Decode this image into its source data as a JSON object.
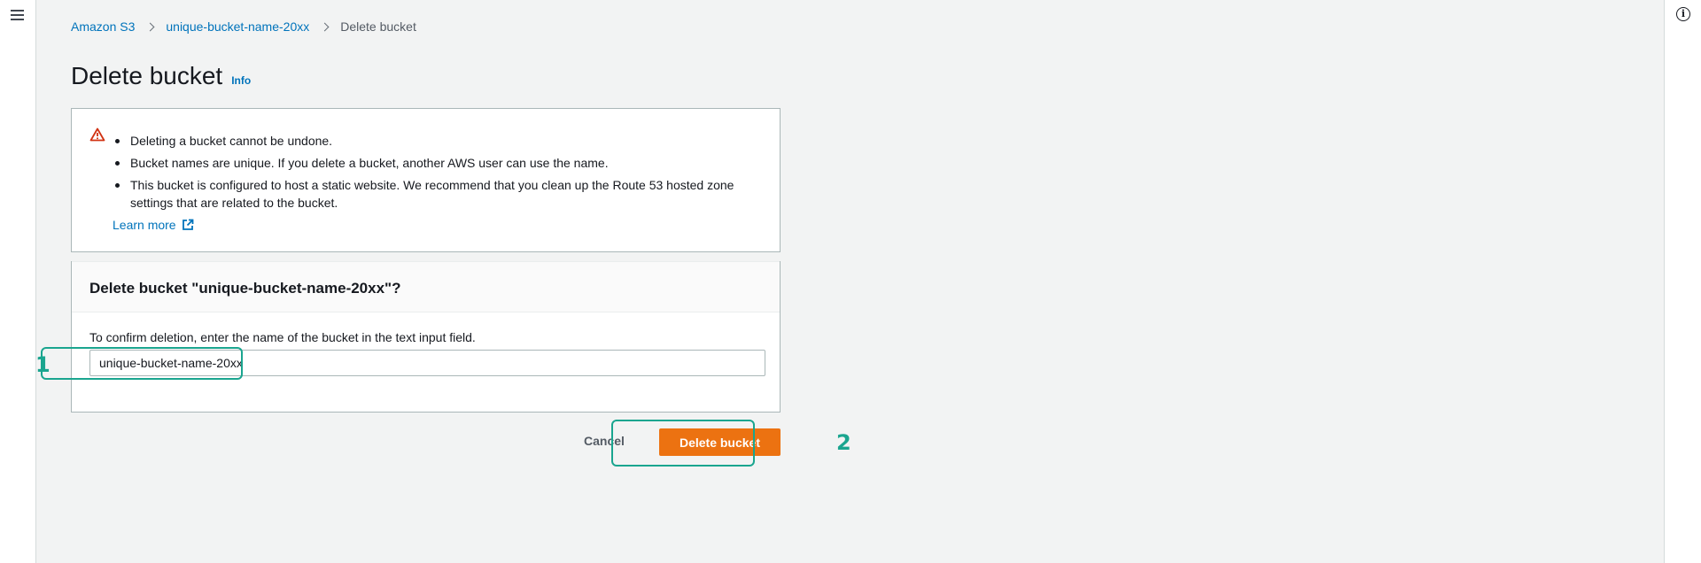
{
  "breadcrumb": {
    "items": [
      "Amazon S3",
      "unique-bucket-name-20xx"
    ],
    "current": "Delete bucket"
  },
  "page": {
    "title": "Delete bucket",
    "info_link": "Info"
  },
  "warning": {
    "icon": "warning-triangle-icon",
    "bullets": [
      "Deleting a bucket cannot be undone.",
      "Bucket names are unique. If you delete a bucket, another AWS user can use the name.",
      "This bucket is configured to host a static website. We recommend that you clean up the Route 53 hosted zone settings that are related to the bucket."
    ],
    "learn_more": "Learn more"
  },
  "confirm": {
    "header": "Delete bucket \"unique-bucket-name-20xx\"?",
    "instruction": "To confirm deletion, enter the name of the bucket in the text input field.",
    "input_value": "unique-bucket-name-20xx"
  },
  "actions": {
    "cancel_label": "Cancel",
    "delete_label": "Delete bucket"
  },
  "markers": {
    "one": "1",
    "two": "2"
  },
  "colors": {
    "accent_orange": "#ec7211",
    "link_blue": "#0073bb",
    "highlight_teal": "#1aa58f"
  }
}
